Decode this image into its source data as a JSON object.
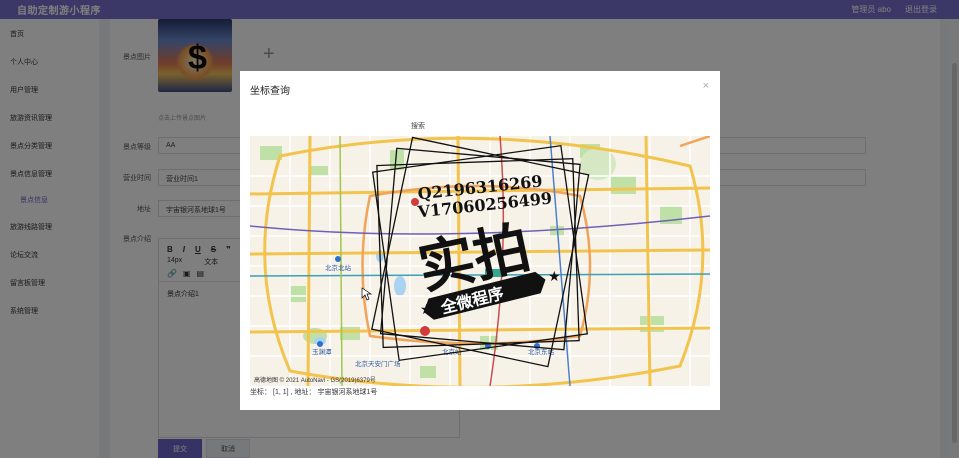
{
  "header": {
    "app_title": "自助定制游小程序",
    "admin_label": "管理员 abo",
    "logout_label": "退出登录"
  },
  "sidebar": {
    "items": [
      {
        "label": "首页"
      },
      {
        "label": "个人中心"
      },
      {
        "label": "用户管理"
      },
      {
        "label": "旅游资讯管理"
      },
      {
        "label": "景点分类管理"
      },
      {
        "label": "景点信息管理"
      },
      {
        "label": "景点信息"
      },
      {
        "label": "旅游线路管理"
      },
      {
        "label": "论坛交流"
      },
      {
        "label": "留言板管理"
      },
      {
        "label": "系统管理"
      }
    ]
  },
  "form": {
    "image_label": "景点图片",
    "upload_hint": "点击上传景点图片",
    "level_label": "景点等级",
    "level_value": "AA",
    "hours_label": "营业时间",
    "hours_value": "营业时间1",
    "address_label": "地址",
    "address_value": "宇宙银河系地球1号",
    "intro_label": "景点介绍",
    "editor_toolbar": {
      "bold": "B",
      "italic": "I",
      "underline": "U",
      "strike": "S",
      "quote": "❞",
      "font_size": "14px",
      "text_label": "文本",
      "link_icon": "🔗",
      "image_icon": "▣",
      "video_icon": "▤"
    },
    "intro_value": "景点介绍1",
    "submit_label": "提交",
    "cancel_label": "取消"
  },
  "modal": {
    "title": "坐标查询",
    "close_label": "×",
    "search_label": "搜索",
    "coords_prefix": "坐标：",
    "coords_value": "[1, 1]",
    "address_prefix": "地址：",
    "address_value": "宇宙银河系地球1号",
    "map_copyright": "高德地图 © 2021 AutoNavi - GS(2019)6379号",
    "map_labels": {
      "north_station": "北京北站",
      "beijing_station": "北京站",
      "east_station": "北京东站",
      "west_station": "北京西站",
      "yuyuantan": "玉渊潭",
      "tiananmen": "北京天安门广场"
    }
  },
  "watermark": {
    "qq": "Q2196316269",
    "wechat": "V17060256499",
    "big_text": "实拍",
    "banner_text": "全微程序"
  },
  "colors": {
    "accent": "#6d64c8",
    "topbar": "#7670cf",
    "overlay": "rgba(0,0,0,0.5)"
  }
}
